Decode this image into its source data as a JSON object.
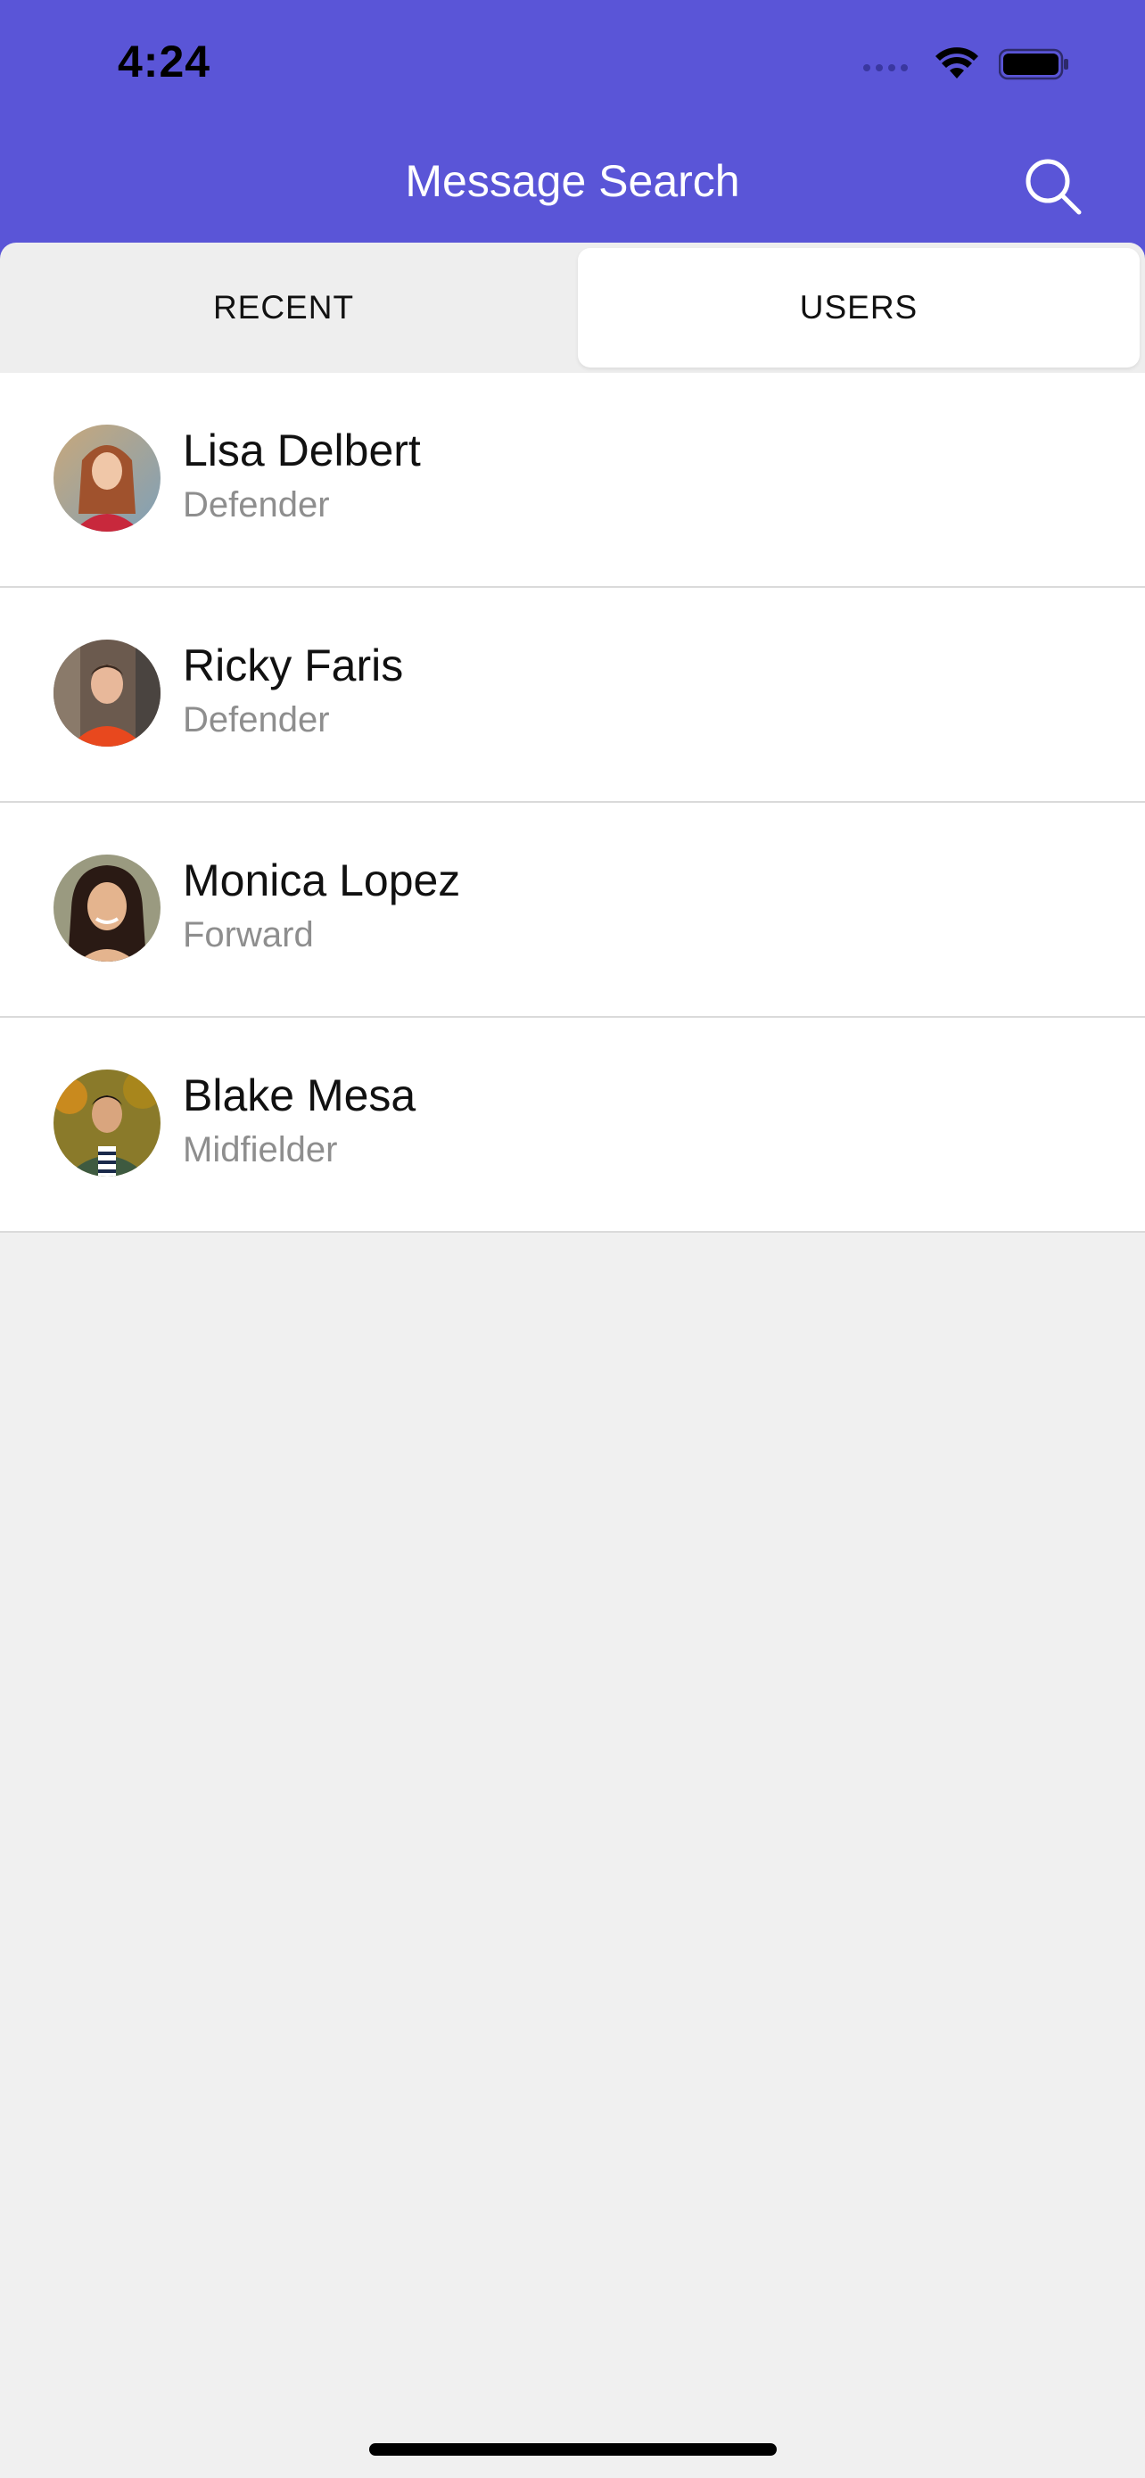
{
  "status_bar": {
    "time": "4:24"
  },
  "nav": {
    "title": "Message Search",
    "search_icon": "search-icon"
  },
  "tabs": [
    {
      "label": "RECENT",
      "selected": false
    },
    {
      "label": "USERS",
      "selected": true
    }
  ],
  "users": [
    {
      "name": "Lisa Delbert",
      "role": "Defender"
    },
    {
      "name": "Ricky Faris",
      "role": "Defender"
    },
    {
      "name": "Monica Lopez",
      "role": "Forward"
    },
    {
      "name": "Blake Mesa",
      "role": "Midfielder"
    }
  ],
  "colors": {
    "header_bg": "#5a55d7",
    "page_bg": "#f0f0f0",
    "secondary_text": "#8e8e8e"
  }
}
